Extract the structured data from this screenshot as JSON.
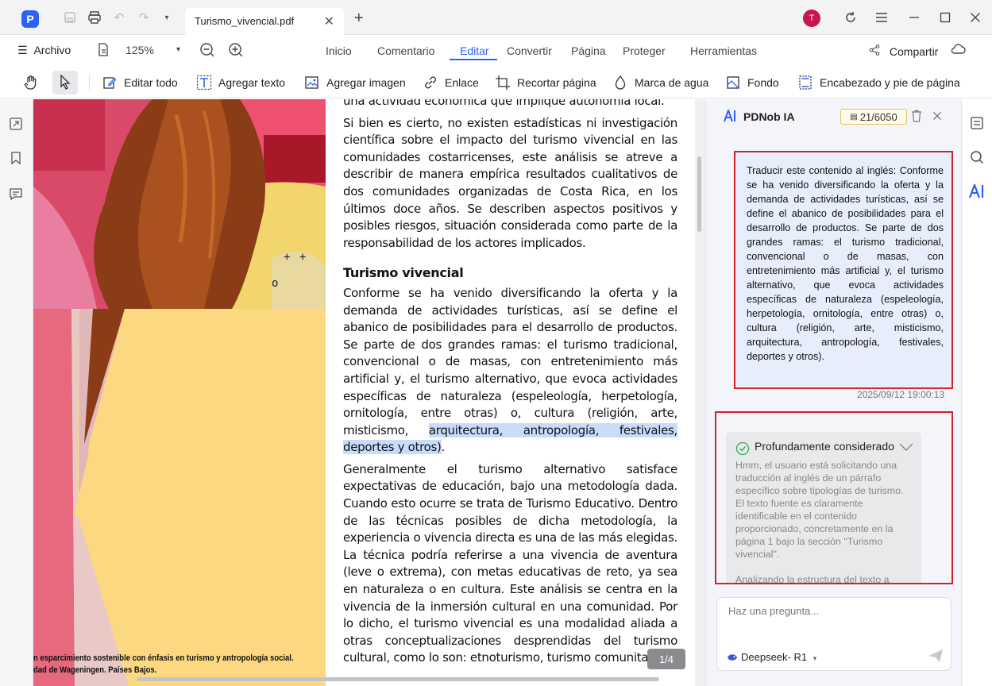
{
  "app": {
    "logo_text": "P"
  },
  "tabs": [
    {
      "label": "Turismo_vivencial.pdf"
    }
  ],
  "user": {
    "initial": "T"
  },
  "menu": {
    "file_label": "Archivo",
    "zoom": "125%",
    "items": [
      "Inicio",
      "Comentario",
      "Editar",
      "Convertir",
      "Página",
      "Proteger",
      "Herramientas"
    ],
    "active": "Editar",
    "share_label": "Compartir"
  },
  "toolbar": {
    "edit_all": "Editar todo",
    "add_text": "Agregar texto",
    "add_image": "Agregar imagen",
    "link": "Enlace",
    "crop": "Recortar página",
    "watermark": "Marca de agua",
    "background": "Fondo",
    "header_footer": "Encabezado y pie de página"
  },
  "document": {
    "line_top": "una actividad económica que implique autonomía local.",
    "para1": "Si bien es cierto, no existen estadísticas ni investigación científica sobre el impacto del turismo vivencial en las comunidades costarricenses, este análisis se atreve a describir de manera empírica resultados cualitativos de dos comunidades organizadas de Costa Rica, en los últimos doce años. Se describen aspectos positivos y posibles riesgos, situación considerada como parte de la responsabilidad de los actores implicados.",
    "heading": "Turismo vivencial",
    "para2_plain": "Conforme se ha venido diversificando la oferta y la demanda de actividades turísticas, así se define el abanico de posibilidades para el desarrollo de productos. Se parte de dos grandes ramas: el turismo tradicional, convencional o de masas, con entretenimiento más artificial y, el turismo alternativo, que evoca actividades específicas de naturaleza (espeleología, herpetología, ornitología, entre otras) o, cultura (religión, arte, misticismo, ",
    "para2_highlight": "arquitectura, antropología, festivales, deportes y otros)",
    "para2_end": ".",
    "para3": "Generalmente el turismo alternativo satisface expectativas de educación, bajo una metodología dada. Cuando esto ocurre se trata de Turismo Educativo. Dentro de las técnicas posibles de dicha metodología, la experiencia o vivencia directa es una de las más elegidas. La técnica podría referirse a una vivencia de aventura (leve o extrema), con metas educativas de reto, ya sea en naturaleza o en cultura. Este análisis se centra en la vivencia de la inmersión cultural en una comunidad. Por lo dicho, el turismo vivencial es una modalidad aliada a otras conceptualizaciones desprendidas del turismo cultural, como lo son: etnoturismo, turismo comunitario,",
    "caption_line1": "n esparcimiento sostenible con énfasis en turismo y antropología social.",
    "caption_line2": "dad de Wageningen. Países Bajos.",
    "page_indicator": "1/4"
  },
  "ai": {
    "title": "PDNob IA",
    "counter": "21/6050",
    "user_message": "Traducir este contenido al inglés: Conforme se ha venido diversificando la oferta y la demanda de actividades turísticas, así se define el abanico de posibilidades para el desarrollo de productos. Se parte de dos grandes ramas: el turismo tradicional, convencional o de masas, con entretenimiento más artificial y, el turismo alternativo, que evoca actividades específicas de naturaleza (espeleología, herpetología, ornitología, entre otras) o, cultura (religión, arte, misticismo, arquitectura, antropología, festivales, deportes y otros).",
    "timestamp": "2025/09/12 19:00:13",
    "thinking_title": "Profundamente considerado",
    "thinking_text": "Hmm, el usuario está solicitando una traducción al inglés de un párrafo específico sobre tipologías de turismo. El texto fuente es claramente identificable en el contenido proporcionado, concretamente en la página 1 bajo la sección \"Turismo vivencial\".",
    "thinking_text2": "Analizando la estructura del texto a",
    "input_placeholder": "Haz una pregunta...",
    "model": "Deepseek- R1"
  },
  "colors": {
    "accent": "#2c63f5",
    "highlight_box": "#d3222a"
  }
}
